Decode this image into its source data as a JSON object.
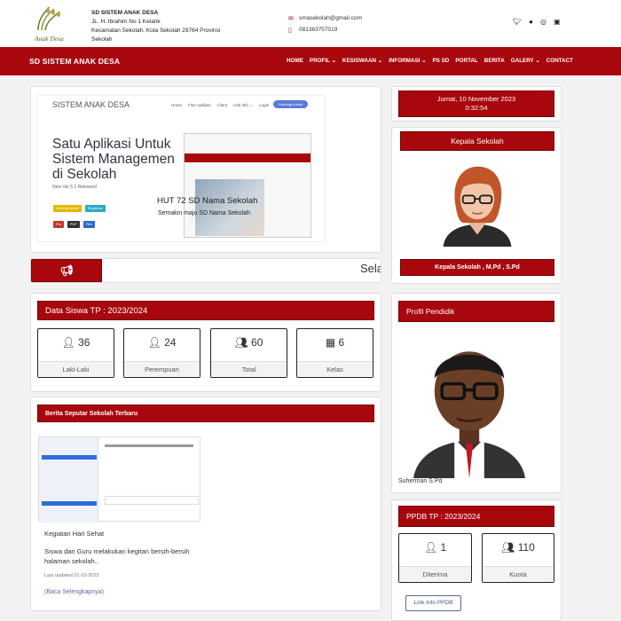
{
  "header": {
    "school_name": "SD SISTEM ANAK DESA",
    "address_line1": "JL. H. Ibrahim No 1 Kelarik",
    "address_line2": "Kecamatan Sekolah, Kota Sekolah 29764 Provinsi",
    "address_line3": "Sekolah",
    "email": "smasekolah@gmail.com",
    "phone": "081363757019",
    "logo_text": "Anak Desa"
  },
  "nav": {
    "brand": "SD SISTEM ANAK DESA",
    "items": [
      {
        "label": "HOME"
      },
      {
        "label": "PROFIL ⌄"
      },
      {
        "label": "KESISWAAN ⌄"
      },
      {
        "label": "INFORMASI ⌄"
      },
      {
        "label": "PS SD"
      },
      {
        "label": "PORTAL"
      },
      {
        "label": "BERITA"
      },
      {
        "label": "GALERY ⌄"
      },
      {
        "label": "CONTACT"
      }
    ]
  },
  "slider": {
    "site_title": "SISTEM ANAK DESA",
    "nav_items": [
      "Home",
      "Fitur Aplikasi",
      "Client",
      "Link Info ⌄",
      "Login"
    ],
    "button": "Hubungi Admin",
    "headline": "Satu Aplikasi Untuk Sistem Managemen di Sekolah",
    "version": "New Ver 5.1 Released",
    "chips1": [
      "Hubungi Admin",
      "Registrasi"
    ],
    "chips2": [
      "Pro",
      "PHP",
      "Flex"
    ],
    "caption_title": "HUT 72 SD Nama Sekolah",
    "caption_sub": "Semakin maju SD Nama Sekolah"
  },
  "ticker": {
    "text": "Sela"
  },
  "siswa": {
    "title": "Data Siswa TP : 2023/2024",
    "stats": [
      {
        "value": "36",
        "label": "Laki-Laki"
      },
      {
        "value": "24",
        "label": "Perempuan"
      },
      {
        "value": "60",
        "label": "Total"
      },
      {
        "value": "6",
        "label": "Kelas"
      }
    ]
  },
  "berita": {
    "title": "Berita Seputar Sekolah Terbaru",
    "item_title": "Kegiatan Hari Sehat",
    "item_excerpt1": "Siswa dan Guru melakukan kegitan bersih-bersih",
    "item_excerpt2": "halaman sekolah..",
    "item_date": "Last updated 01-10-2023",
    "read_more": "(Baca Selengkapnya)"
  },
  "sidebar": {
    "date": "Jumat, 10 November 2023",
    "time": "0:32:54",
    "kepala_title": "Kepala Sekolah",
    "kepala_name": "Kepala Sekolah , M.Pd , S.Pd",
    "profil_title": "Profil Pendidik",
    "profil_name": "Suherman S.Pd",
    "ppdb_title": "PPDB TP : 2023/2024",
    "ppdb_stats": [
      {
        "value": "1",
        "label": "Diterima"
      },
      {
        "value": "110",
        "label": "Kuota"
      }
    ],
    "ppdb_link": "Link Info PPDB"
  },
  "colors": {
    "brand_red": "#a8070d"
  }
}
